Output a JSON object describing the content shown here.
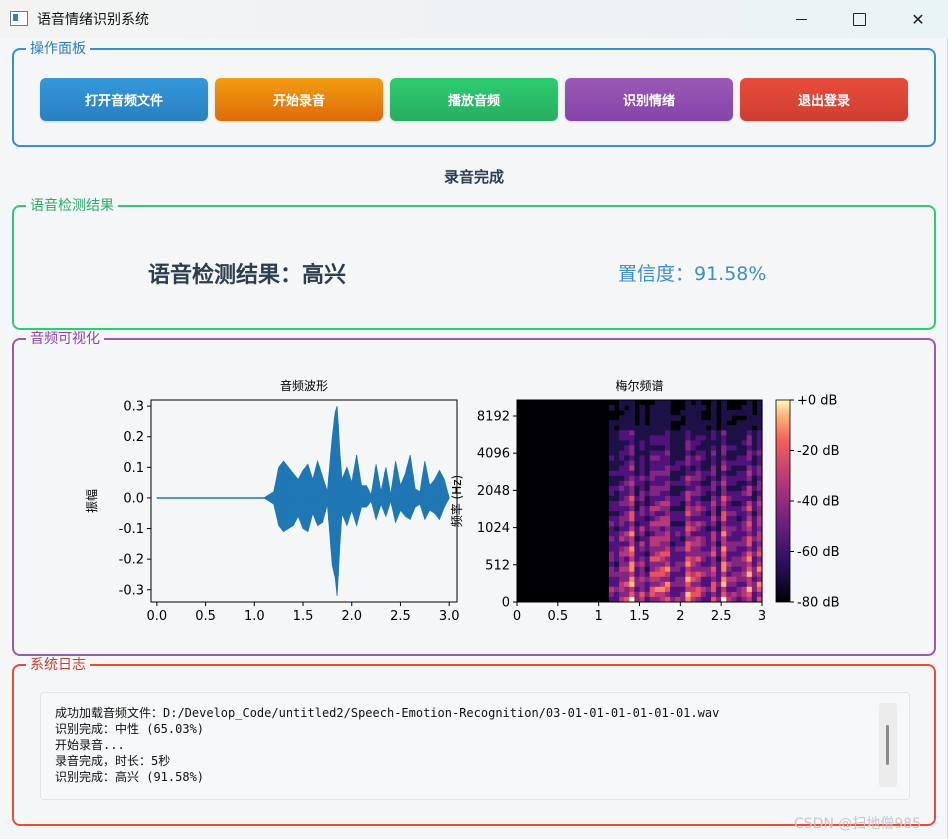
{
  "window": {
    "title": "语音情绪识别系统",
    "controls": {
      "minimize": "min-icon",
      "maximize": "max-icon",
      "close": "✕"
    }
  },
  "ops_panel": {
    "title": "操作面板",
    "buttons": [
      {
        "label": "打开音频文件",
        "color": "#3498db"
      },
      {
        "label": "开始录音",
        "color": "#f39c12"
      },
      {
        "label": "播放音频",
        "color": "#2ecc71"
      },
      {
        "label": "识别情绪",
        "color": "#9b59b6"
      },
      {
        "label": "退出登录",
        "color": "#e74c3c"
      }
    ]
  },
  "status": {
    "text": "录音完成"
  },
  "result_panel": {
    "title": "语音检测结果",
    "result_text": "语音检测结果：高兴",
    "confidence_text": "置信度：91.58%"
  },
  "viz_panel": {
    "title": "音频可视化"
  },
  "chart_data": [
    {
      "type": "line",
      "title": "音频波形",
      "xlabel": "",
      "ylabel": "振幅",
      "xlim": [
        -0.06,
        3.08
      ],
      "ylim": [
        -0.34,
        0.32
      ],
      "xticks": [
        "0.0",
        "0.5",
        "1.0",
        "1.5",
        "2.0",
        "2.5",
        "3.0"
      ],
      "yticks": [
        "0.3",
        "0.2",
        "0.1",
        "0.0",
        "-0.1",
        "-0.2",
        "-0.3"
      ],
      "color": "#1f77b4",
      "envelope": {
        "x": [
          0.0,
          1.0,
          1.1,
          1.2,
          1.25,
          1.3,
          1.35,
          1.4,
          1.45,
          1.5,
          1.55,
          1.6,
          1.65,
          1.7,
          1.75,
          1.8,
          1.83,
          1.85,
          1.88,
          1.9,
          1.95,
          2.0,
          2.05,
          2.1,
          2.15,
          2.2,
          2.25,
          2.3,
          2.35,
          2.4,
          2.45,
          2.5,
          2.55,
          2.6,
          2.65,
          2.7,
          2.75,
          2.8,
          2.85,
          2.9,
          2.95,
          3.0
        ],
        "upper": [
          0.0,
          0.0,
          0.0,
          0.02,
          0.1,
          0.12,
          0.1,
          0.08,
          0.06,
          0.09,
          0.11,
          0.06,
          0.12,
          0.07,
          0.02,
          0.2,
          0.28,
          0.3,
          0.14,
          0.06,
          0.1,
          0.05,
          0.14,
          0.04,
          0.04,
          0.01,
          0.11,
          0.02,
          0.1,
          0.01,
          0.12,
          0.04,
          0.08,
          0.14,
          0.03,
          0.02,
          0.12,
          0.04,
          0.06,
          0.09,
          0.06,
          0.0
        ],
        "lower": [
          0.0,
          0.0,
          0.0,
          -0.02,
          -0.09,
          -0.11,
          -0.1,
          -0.09,
          -0.06,
          -0.1,
          -0.11,
          -0.05,
          -0.09,
          -0.08,
          -0.02,
          -0.22,
          -0.26,
          -0.32,
          -0.14,
          -0.05,
          -0.09,
          -0.04,
          -0.09,
          -0.03,
          -0.03,
          -0.01,
          -0.07,
          -0.02,
          -0.06,
          -0.01,
          -0.08,
          -0.04,
          -0.06,
          -0.07,
          -0.03,
          -0.02,
          -0.07,
          -0.04,
          -0.05,
          -0.07,
          -0.03,
          0.0
        ]
      }
    },
    {
      "type": "heatmap",
      "title": "梅尔频谱",
      "xlabel": "",
      "ylabel": "频率 (Hz)",
      "xticks": [
        "0",
        "0.5",
        "1",
        "1.5",
        "2",
        "2.5",
        "3"
      ],
      "yticks": [
        "8192",
        "4096",
        "2048",
        "1024",
        "512",
        "0"
      ],
      "xlim": [
        0,
        3
      ],
      "colorbar": {
        "ticks": [
          "+0 dB",
          "-20 dB",
          "-40 dB",
          "-60 dB",
          "-80 dB"
        ],
        "range": [
          -80,
          0
        ],
        "colormap": "magma"
      },
      "silence_until_sec": 1.15
    }
  ],
  "log_panel": {
    "title": "系统日志",
    "lines": [
      "成功加载音频文件：D:/Develop_Code/untitled2/Speech-Emotion-Recognition/03-01-01-01-01-01-01.wav",
      "识别完成：中性 (65.03%)",
      "开始录音...",
      "录音完成，时长：5秒",
      "识别完成：高兴 (91.58%)"
    ]
  },
  "watermark": "CSDN @扫地僧985"
}
